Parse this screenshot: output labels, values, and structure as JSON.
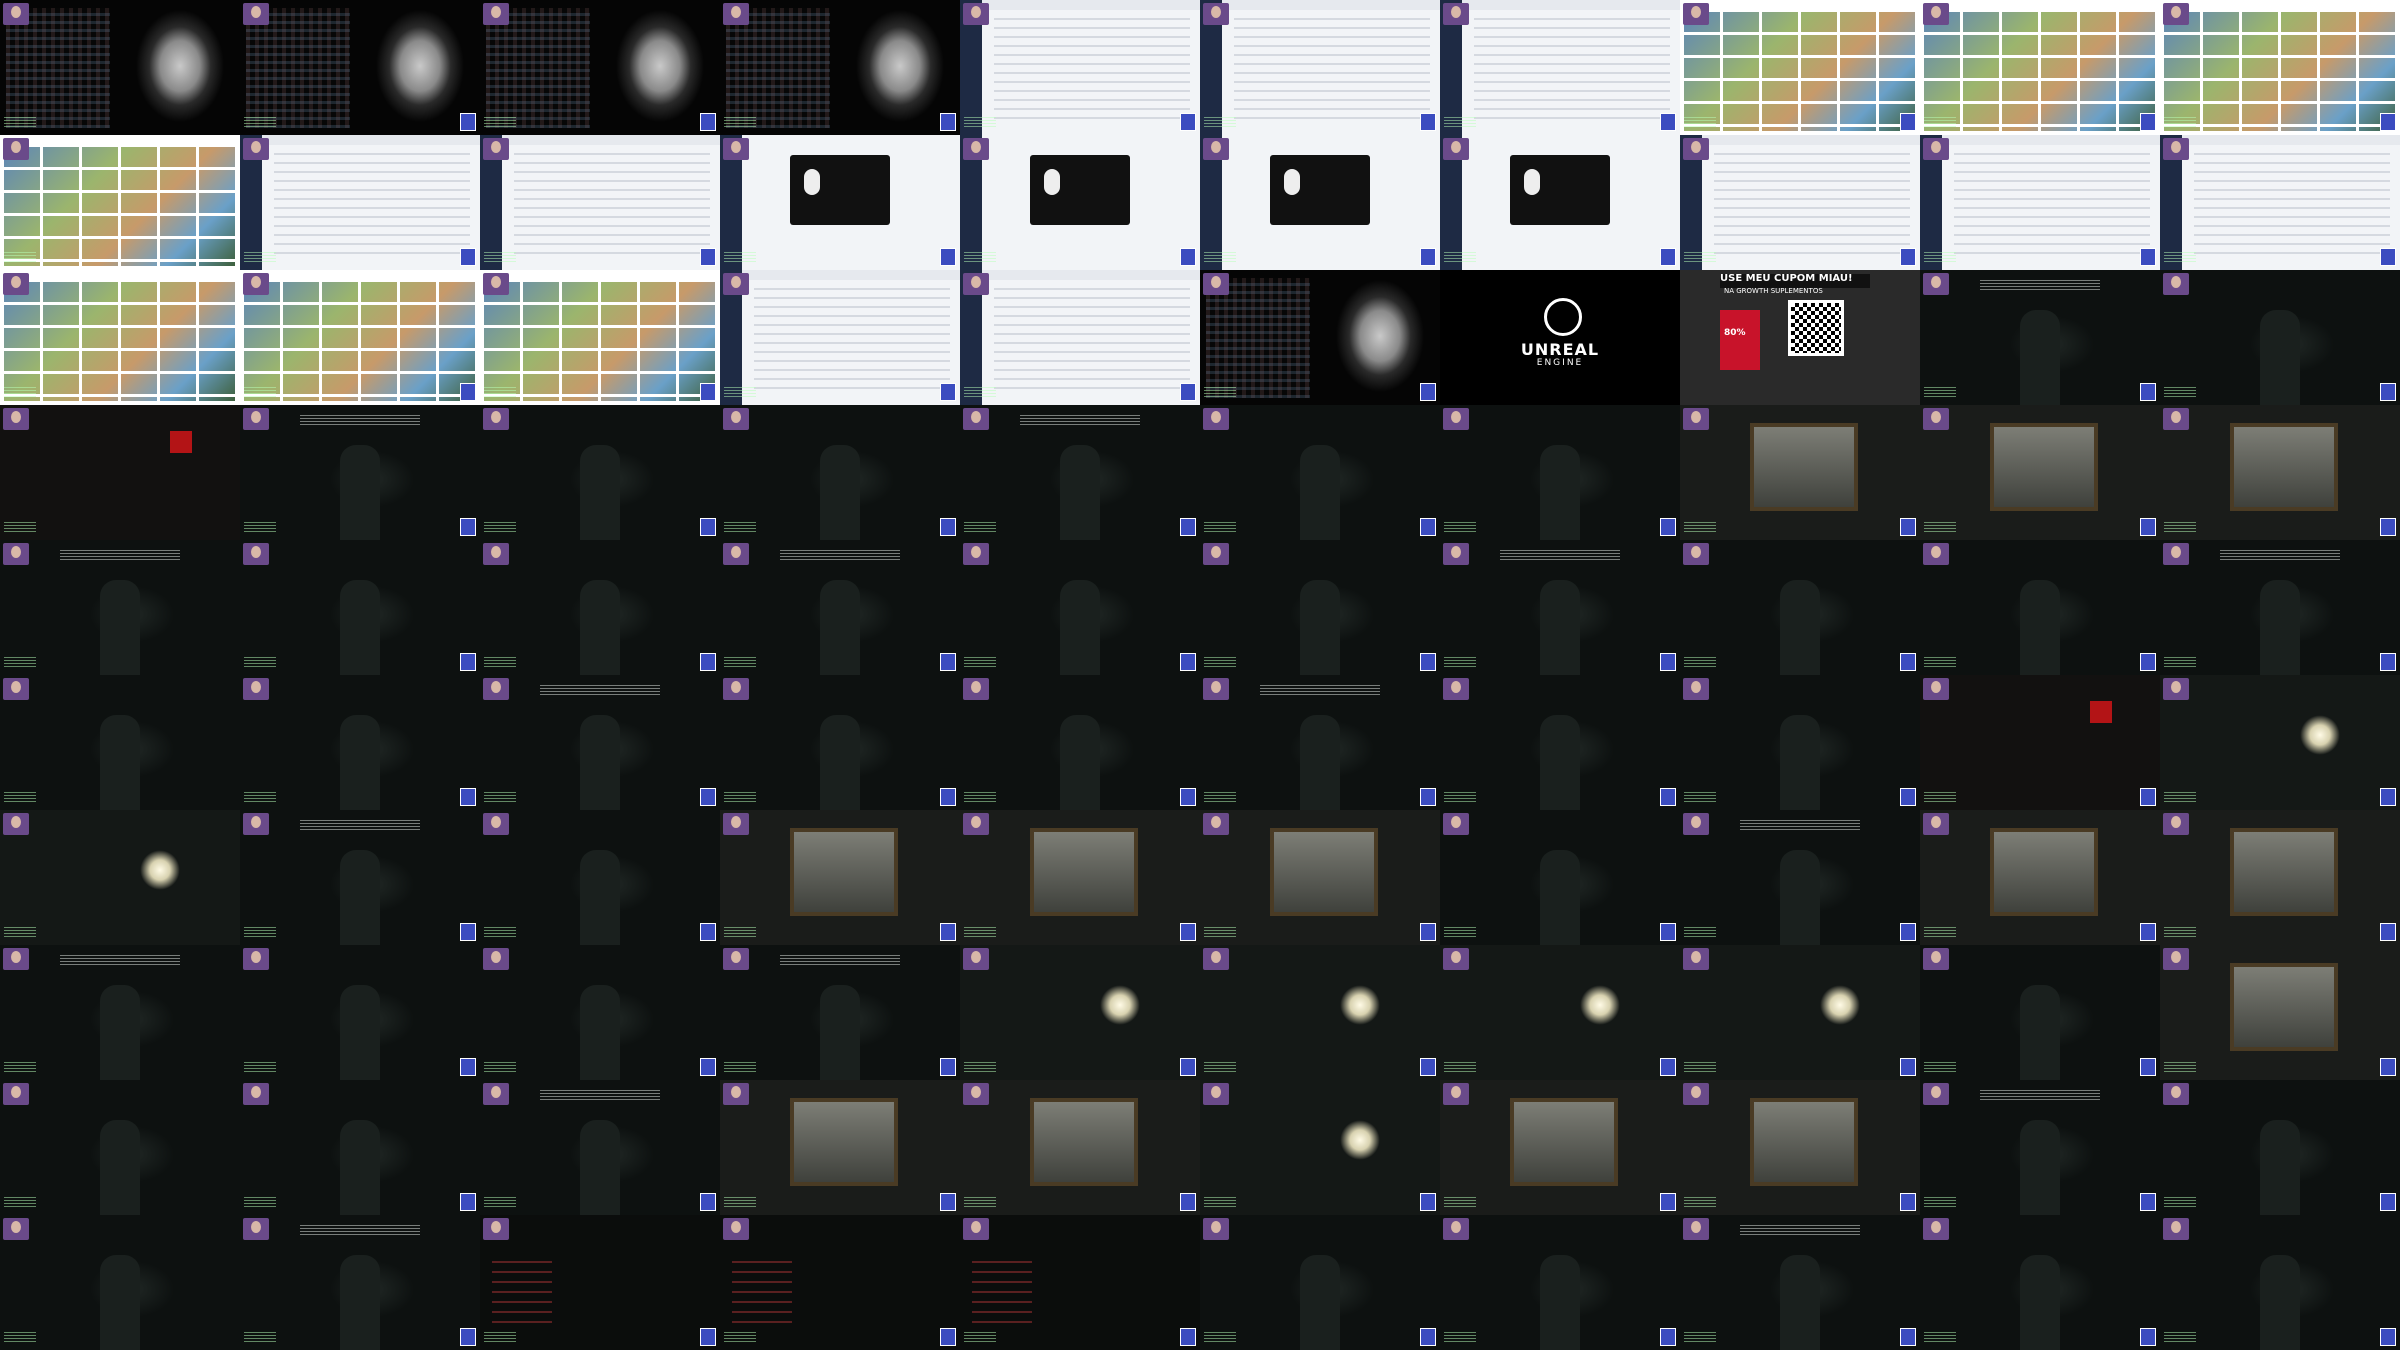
{
  "image_type": "video contact sheet",
  "grid": {
    "columns": 10,
    "rows": 10
  },
  "overlay_texts": {
    "promo_headline": "USE MEU CUPOM MIAU!",
    "promo_subline": "NA GROWTH SUPLEMENTOS",
    "promo_badge": "80%",
    "unreal_logo_title": "UNREAL",
    "unreal_logo_subtitle": "ENGINE"
  },
  "tiles": [
    "portrait",
    "portrait",
    "portrait",
    "portrait",
    "browser",
    "browser",
    "browser",
    "photos",
    "photos",
    "photos",
    "photos",
    "browser",
    "browser",
    "dialog",
    "dialog",
    "dialog",
    "dialog",
    "browser",
    "browser",
    "browser",
    "photos",
    "photos",
    "photos",
    "browser",
    "browser",
    "portrait",
    "unreal",
    "promo",
    "dark",
    "dark",
    "red",
    "dark",
    "dark",
    "dark",
    "dark",
    "dark",
    "dark",
    "frame",
    "frame",
    "frame",
    "dark",
    "dark",
    "dark",
    "dark",
    "dark",
    "dark",
    "dark",
    "dark",
    "dark",
    "dark",
    "dark",
    "dark",
    "dark",
    "dark",
    "dark",
    "dark",
    "dark",
    "dark",
    "red",
    "light",
    "light",
    "dark",
    "dark",
    "frame",
    "frame",
    "frame",
    "dark",
    "dark",
    "frame",
    "frame",
    "dark",
    "dark",
    "dark",
    "dark",
    "light",
    "light",
    "light",
    "light",
    "dark",
    "frame",
    "dark",
    "dark",
    "dark",
    "frame",
    "frame",
    "light",
    "frame",
    "frame",
    "dark",
    "dark",
    "dark",
    "dark",
    "menu",
    "menu",
    "menu",
    "dark",
    "dark",
    "dark",
    "dark",
    "dark"
  ],
  "icons": {
    "webcam": "webcam-overlay-icon",
    "qr": "qr-code-icon"
  }
}
